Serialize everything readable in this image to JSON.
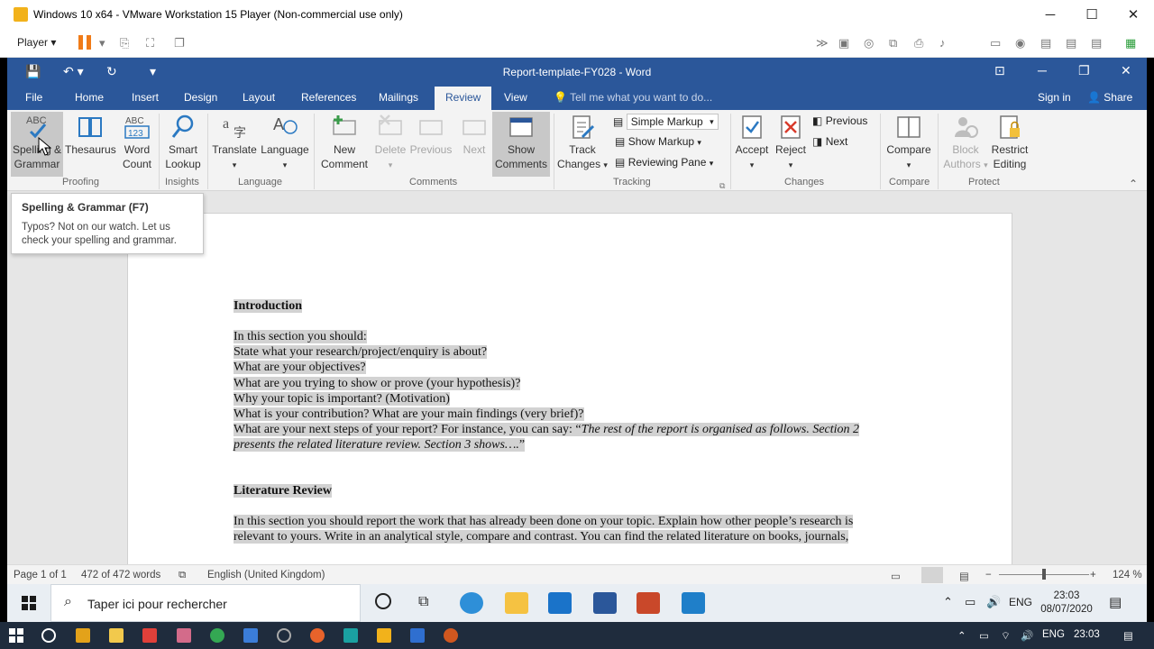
{
  "vmware": {
    "title": "Windows 10 x64 - VMware Workstation 15 Player (Non-commercial use only)",
    "player_menu": "Player"
  },
  "word": {
    "doc_title": "Report-template-FY028 - Word",
    "tabs": [
      "File",
      "Home",
      "Insert",
      "Design",
      "Layout",
      "References",
      "Mailings",
      "Review",
      "View"
    ],
    "active_tab": "Review",
    "tell_me": "Tell me what you want to do...",
    "sign_in": "Sign in",
    "share": "Share"
  },
  "ribbon": {
    "proofing": {
      "label": "Proofing",
      "spelling": [
        "Spelling &",
        "Grammar"
      ],
      "thesaurus": "Thesaurus",
      "word_count": [
        "Word",
        "Count"
      ]
    },
    "insights": {
      "label": "Insights",
      "smart_lookup": [
        "Smart",
        "Lookup"
      ]
    },
    "language": {
      "label": "Language",
      "translate": "Translate",
      "language": "Language"
    },
    "comments": {
      "label": "Comments",
      "new": [
        "New",
        "Comment"
      ],
      "delete": "Delete",
      "previous": "Previous",
      "next": "Next",
      "show": [
        "Show",
        "Comments"
      ]
    },
    "tracking": {
      "label": "Tracking",
      "track": [
        "Track",
        "Changes"
      ],
      "markup_select": "Simple Markup",
      "show_markup": "Show Markup",
      "reviewing_pane": "Reviewing Pane"
    },
    "changes": {
      "label": "Changes",
      "accept": "Accept",
      "reject": "Reject",
      "previous": "Previous",
      "next": "Next"
    },
    "compare": {
      "label": "Compare",
      "compare": "Compare"
    },
    "protect": {
      "label": "Protect",
      "block": [
        "Block",
        "Authors"
      ],
      "restrict": [
        "Restrict",
        "Editing"
      ]
    }
  },
  "tooltip": {
    "title": "Spelling & Grammar (F7)",
    "desc_line1": "Typos? Not on our watch. Let us",
    "desc_line2": "check your spelling and grammar."
  },
  "document": {
    "h1": "Introduction",
    "intro_lines": [
      "In this section you should:",
      "State what your research/project/enquiry is about?",
      "What are your objectives?",
      "What are you trying to show or prove (your hypothesis)?",
      "Why your topic is important? (Motivation)",
      "What is your contribution? What are your main findings (very brief)?"
    ],
    "next_steps_prefix": "What are your next steps of your report? For instance, you can say: “",
    "next_steps_italic_1": "The rest of the report is organised as follows. Section 2",
    "next_steps_italic_2": "presents the related literature review. Section 3 shows….",
    "next_steps_suffix": "”",
    "h2": "Literature Review",
    "lit_line1": "In this section you should report the work that has already been done on your topic. Explain how other people’s research is",
    "lit_line2": "relevant to yours. Write in an analytical style, compare and contrast. You can find the related literature on books, journals,"
  },
  "status": {
    "page": "Page 1 of 1",
    "words": "472 of 472 words",
    "language": "English (United Kingdom)",
    "zoom": "124 %"
  },
  "guest_taskbar": {
    "search_placeholder": "Taper ici pour rechercher",
    "lang": "ENG",
    "time": "23:03",
    "date": "08/07/2020"
  },
  "host_taskbar": {
    "lang": "ENG",
    "time": "23:03"
  }
}
